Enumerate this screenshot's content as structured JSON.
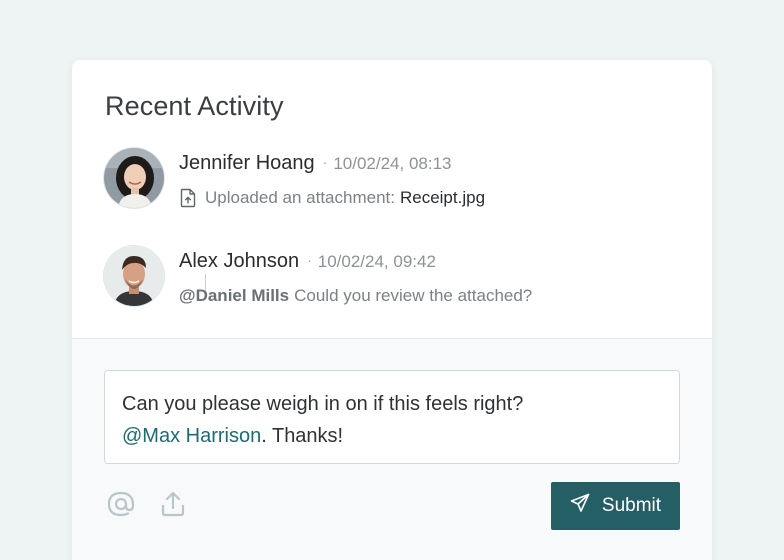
{
  "panel": {
    "title": "Recent Activity"
  },
  "activity": [
    {
      "name": "Jennifer Hoang",
      "separator": "·",
      "timestamp": "10/02/24, 08:13",
      "action_text": "Uploaded an attachment:",
      "attachment": "Receipt.jpg",
      "icon": "file-upload-icon"
    },
    {
      "name": "Alex Johnson",
      "separator": "·",
      "timestamp": "10/02/24, 09:42",
      "mention": "@Daniel Mills",
      "message": "Could you review the attached?"
    }
  ],
  "composer": {
    "text_line1": "Can you please weigh in on if this feels right?",
    "mention": "@Max Harrison",
    "text_tail": ". Thanks!"
  },
  "toolbar": {
    "mention_icon": "at-sign-icon",
    "upload_icon": "upload-icon",
    "submit_label": "Submit",
    "submit_icon": "send-icon"
  },
  "colors": {
    "accent": "#255f66",
    "mention_text": "#1f6a73",
    "background": "#eef4f4"
  }
}
